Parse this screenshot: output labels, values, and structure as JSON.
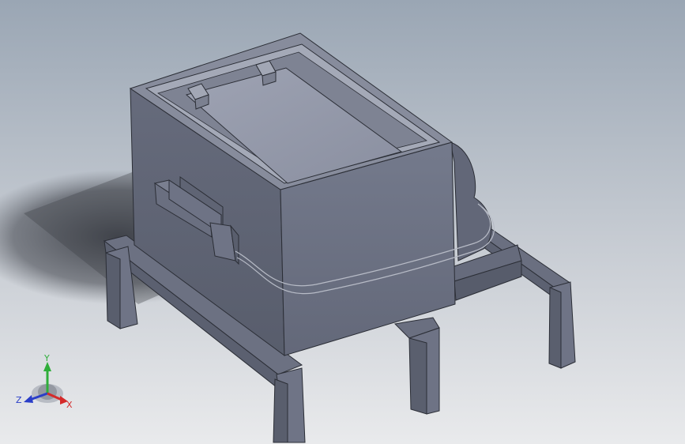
{
  "viewport": {
    "background_top": "#9aa6b4",
    "background_bottom": "#e9eaec"
  },
  "model": {
    "body_color": "#6c7282",
    "front_face_color": "#6f7587",
    "side_face_color": "#5f6474",
    "top_rim_color": "#8b90a0",
    "lid_color": "#9398a8",
    "frame_color": "#676c7c",
    "edge_color": "#2b2e36"
  },
  "triad": {
    "labels": {
      "x": "X",
      "y": "Y",
      "z": "Z"
    },
    "colors": {
      "x": "#d42a2a",
      "y": "#2fae3a",
      "z": "#2a3ec8"
    }
  }
}
